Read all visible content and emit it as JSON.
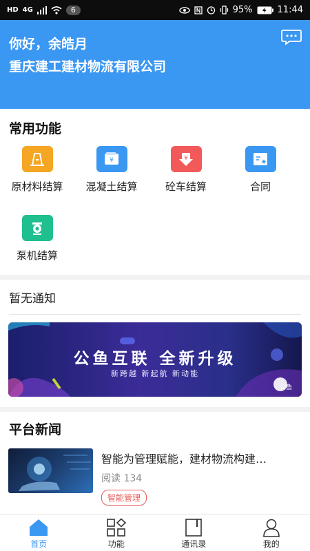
{
  "status_bar": {
    "left_badges": [
      "HD",
      "4G"
    ],
    "notification_count": "6",
    "battery": "95%",
    "time": "11:44"
  },
  "header": {
    "greeting": "你好，余皓月",
    "company": "重庆建工建材物流有限公司",
    "bg_color": "#3a97f2"
  },
  "functions": {
    "title": "常用功能",
    "items": [
      {
        "label": "原材料结算",
        "icon": "raw-material-icon",
        "color": "#f5a623"
      },
      {
        "label": "混凝土结算",
        "icon": "concrete-wallet-icon",
        "color": "#3a97f2"
      },
      {
        "label": "砼车结算",
        "icon": "concrete-truck-yen-icon",
        "color": "#f25a5a"
      },
      {
        "label": "合同",
        "icon": "contract-icon",
        "color": "#3a97f2"
      },
      {
        "label": "泵机结算",
        "icon": "pump-icon",
        "color": "#1fbf8f"
      }
    ]
  },
  "notice": {
    "text": "暂无通知",
    "banner": {
      "title": "公鱼互联  全新升级",
      "subtitle": "新跨越  新起航  新动能",
      "brand": "公鱼"
    }
  },
  "news": {
    "title": "平台新闻",
    "items": [
      {
        "title": "智能为管理赋能，建材物流构建…",
        "read": "阅读 134",
        "tag": "智能管理"
      }
    ]
  },
  "tabbar": [
    {
      "label": "首页",
      "icon": "home-icon",
      "active": true
    },
    {
      "label": "功能",
      "icon": "apps-icon",
      "active": false
    },
    {
      "label": "通讯录",
      "icon": "contacts-book-icon",
      "active": false
    },
    {
      "label": "我的",
      "icon": "user-icon",
      "active": false
    }
  ]
}
